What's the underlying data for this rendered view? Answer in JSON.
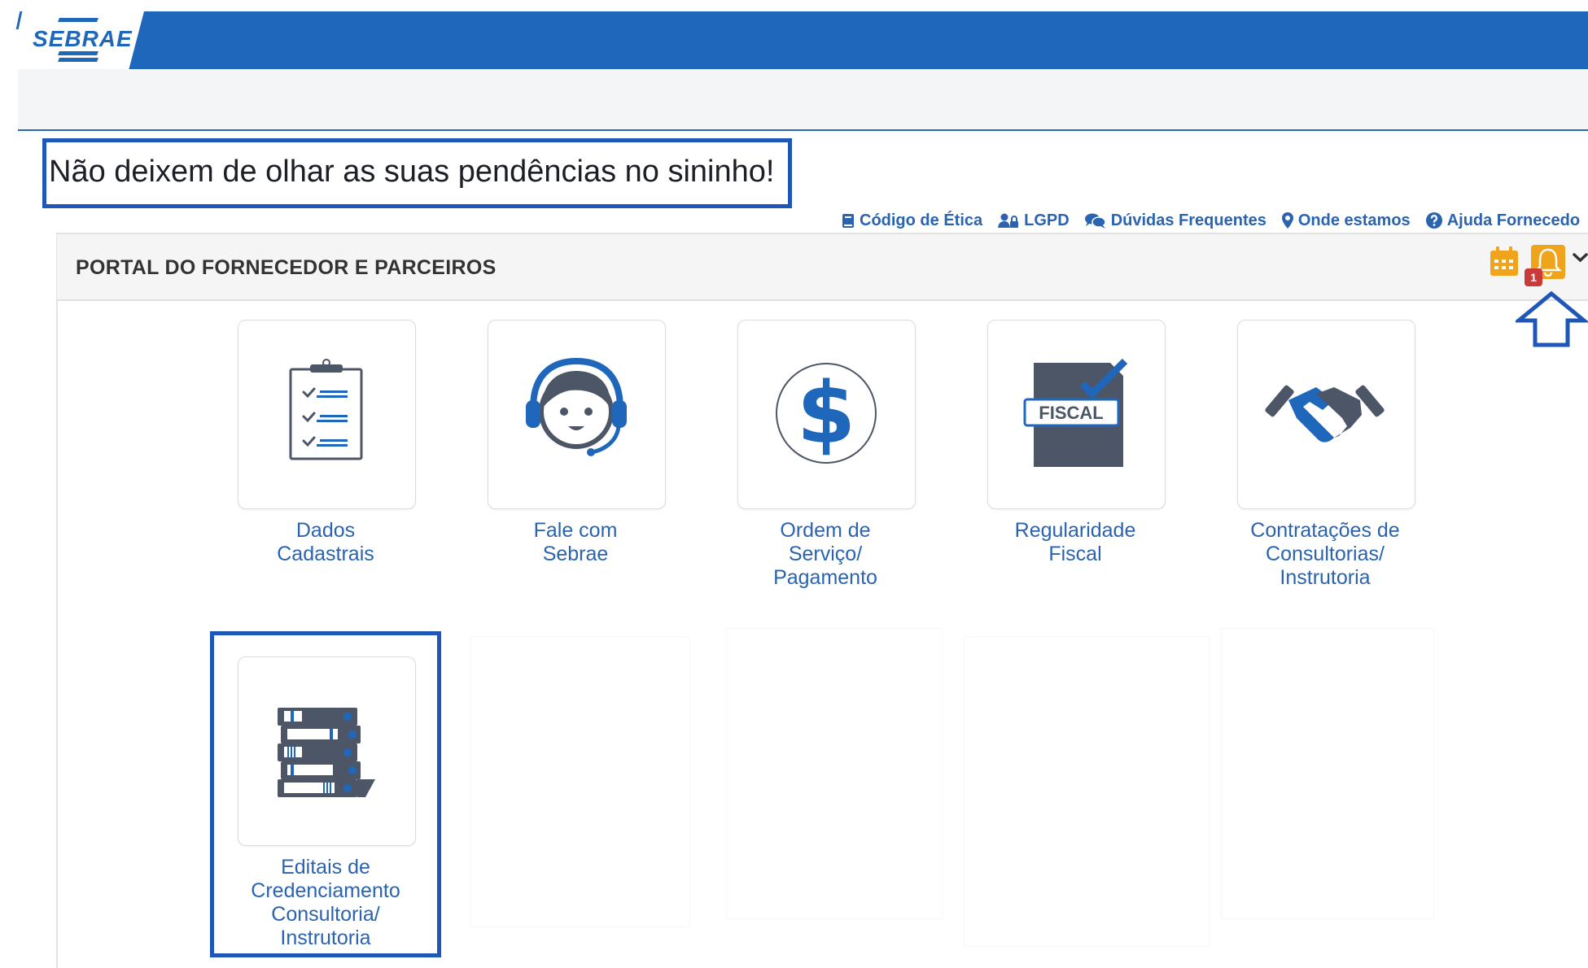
{
  "header": {
    "logo_text": "SEBRAE",
    "brand_color": "#1f67ba"
  },
  "notice": {
    "text": "Não deixem de olhar as suas pendências no sininho!"
  },
  "quick_links": [
    {
      "label": "Código de Ética",
      "icon": "book-icon"
    },
    {
      "label": "LGPD",
      "icon": "user-lock-icon"
    },
    {
      "label": "Dúvidas Frequentes",
      "icon": "comments-icon"
    },
    {
      "label": "Onde estamos",
      "icon": "map-marker-icon"
    },
    {
      "label": "Ajuda Fornecedo",
      "icon": "question-circle-icon"
    }
  ],
  "panel": {
    "title": "PORTAL DO FORNECEDOR E PARCEIROS",
    "notification_count": "1",
    "icons": [
      "calendar-icon",
      "bell-icon",
      "chevron-down-icon"
    ],
    "icon_colors": {
      "calendar": "#f0a41c",
      "bell": "#f0a41c",
      "badge": "#c93b3b"
    }
  },
  "tiles": [
    {
      "label_lines": [
        "Dados",
        "Cadastrais"
      ],
      "icon": "clipboard-checklist-icon"
    },
    {
      "label_lines": [
        "Fale com",
        "Sebrae"
      ],
      "icon": "headset-support-icon"
    },
    {
      "label_lines": [
        "Ordem de",
        "Serviço/",
        "Pagamento"
      ],
      "icon": "dollar-icon"
    },
    {
      "label_lines": [
        "Regularidade",
        "Fiscal"
      ],
      "icon": "fiscal-document-icon",
      "icon_text": "FISCAL"
    },
    {
      "label_lines": [
        "Contratações de",
        "Consultorias/",
        "Instrutoria"
      ],
      "icon": "handshake-icon"
    },
    {
      "label_lines": [
        "Editais de",
        "Credenciamento",
        "Consultoria/",
        "Instrutoria"
      ],
      "icon": "binders-icon"
    }
  ]
}
